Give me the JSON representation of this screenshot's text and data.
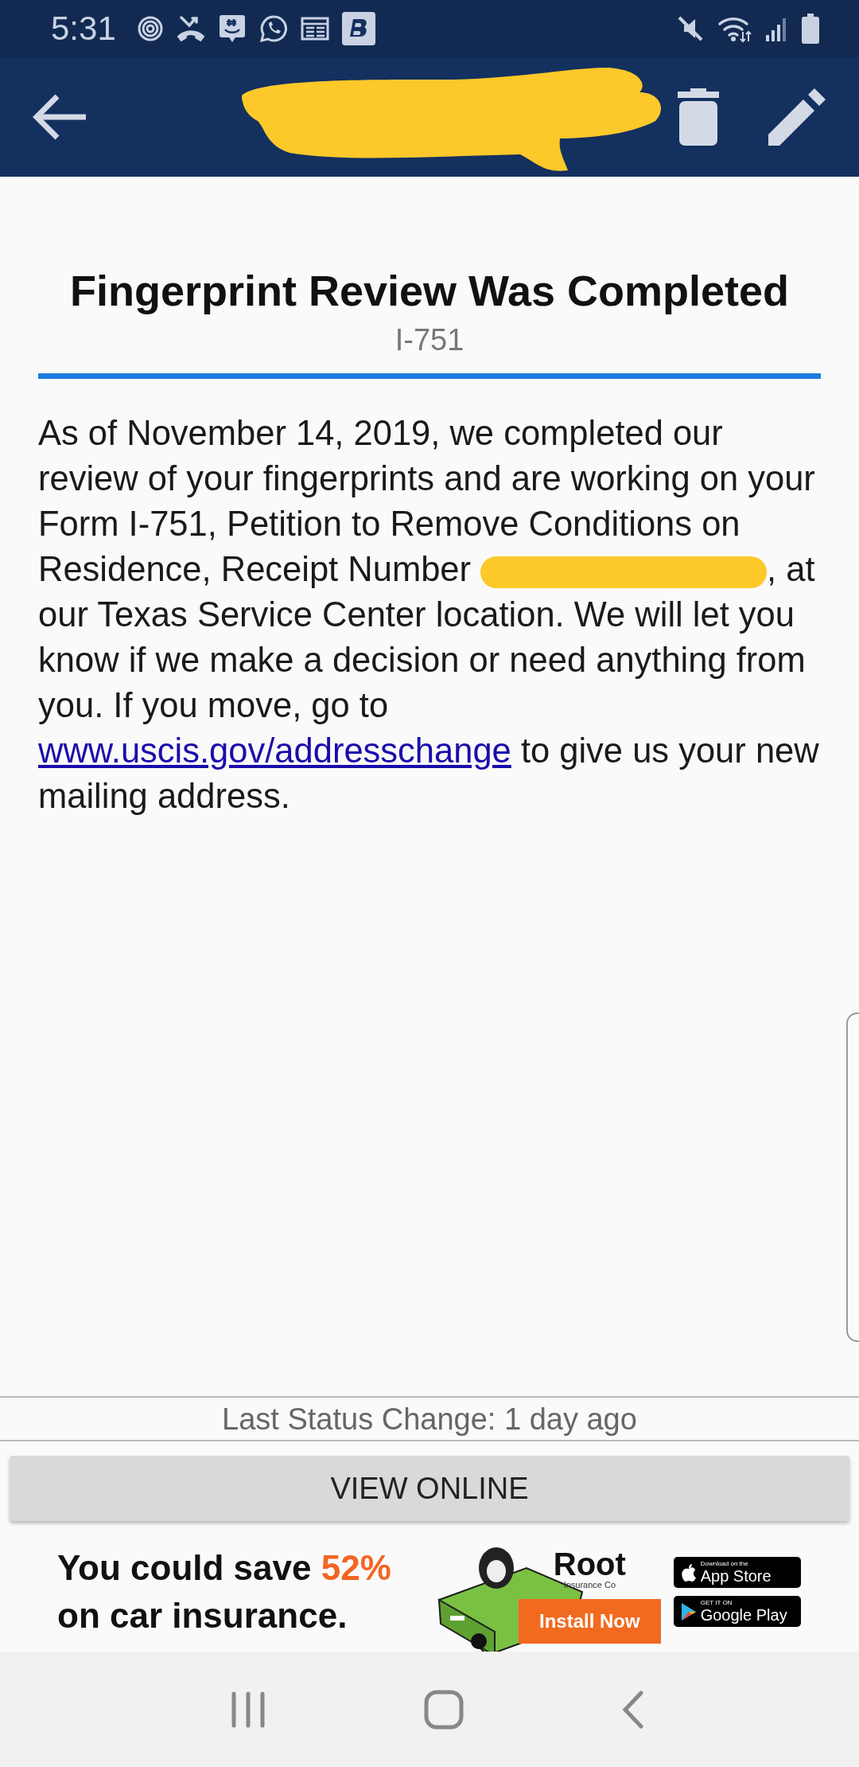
{
  "status_bar": {
    "time": "5:31"
  },
  "message": {
    "title": "Fingerprint Review Was Completed",
    "form": "I-751",
    "text_before": "As of November 14, 2019, we completed our review of your fingerprints and are working on your Form I-751, Petition to Remove Conditions on Residence, Receipt Number",
    "text_after": ", at our Texas Service Center location. We will let you know if we make a decision or need anything from you. If you move, go to",
    "link": "www.uscis.gov/addresschange",
    "text_end": "to give us your new mailing address."
  },
  "last_status": "Last Status Change: 1 day ago",
  "view_button": "VIEW ONLINE",
  "ad": {
    "headline_start": "You could save",
    "highlight": "52%",
    "headline_end": "on car insurance.",
    "brand": "Root",
    "brand_sub": "Insurance Co",
    "install": "Install Now",
    "stores": [
      {
        "kind": "apple",
        "small": "Download on the",
        "name": "App Store"
      },
      {
        "kind": "google",
        "small": "GET IT ON",
        "name": "Google Play"
      }
    ]
  }
}
